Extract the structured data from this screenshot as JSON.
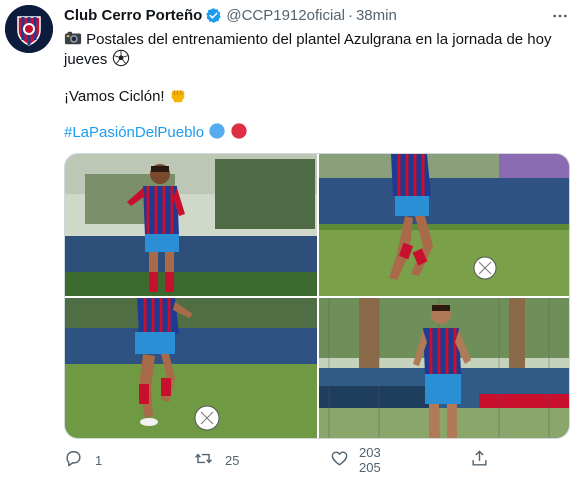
{
  "author": {
    "name": "Club Cerro Porteño",
    "handle": "@CCP1912oficial",
    "separator": "·",
    "time": "38min"
  },
  "tweet": {
    "line1": "Postales del entrenamiento del plantel Azulgrana en la jornada de hoy",
    "line2": "jueves",
    "line3": "¡Vamos Ciclón!",
    "hashtag": "#LaPasiónDelPueblo"
  },
  "icons": {
    "verified": "verified-badge-icon",
    "camera": "camera-emoji",
    "ball": "soccer-ball-emoji",
    "fist": "fist-emoji",
    "blue_circle": "blue-circle-emoji",
    "red_circle": "red-circle-emoji",
    "more": "more-icon",
    "reply": "reply-icon",
    "retweet": "retweet-icon",
    "like": "heart-icon",
    "share": "share-icon"
  },
  "actions": {
    "reply_count": "1",
    "retweet_count": "25",
    "like_count_prev": "203",
    "like_count_next": "205"
  },
  "colors": {
    "accent": "#1d9bf0",
    "muted": "#536471",
    "club_blue": "#1f3a93",
    "club_red": "#c8102e"
  }
}
